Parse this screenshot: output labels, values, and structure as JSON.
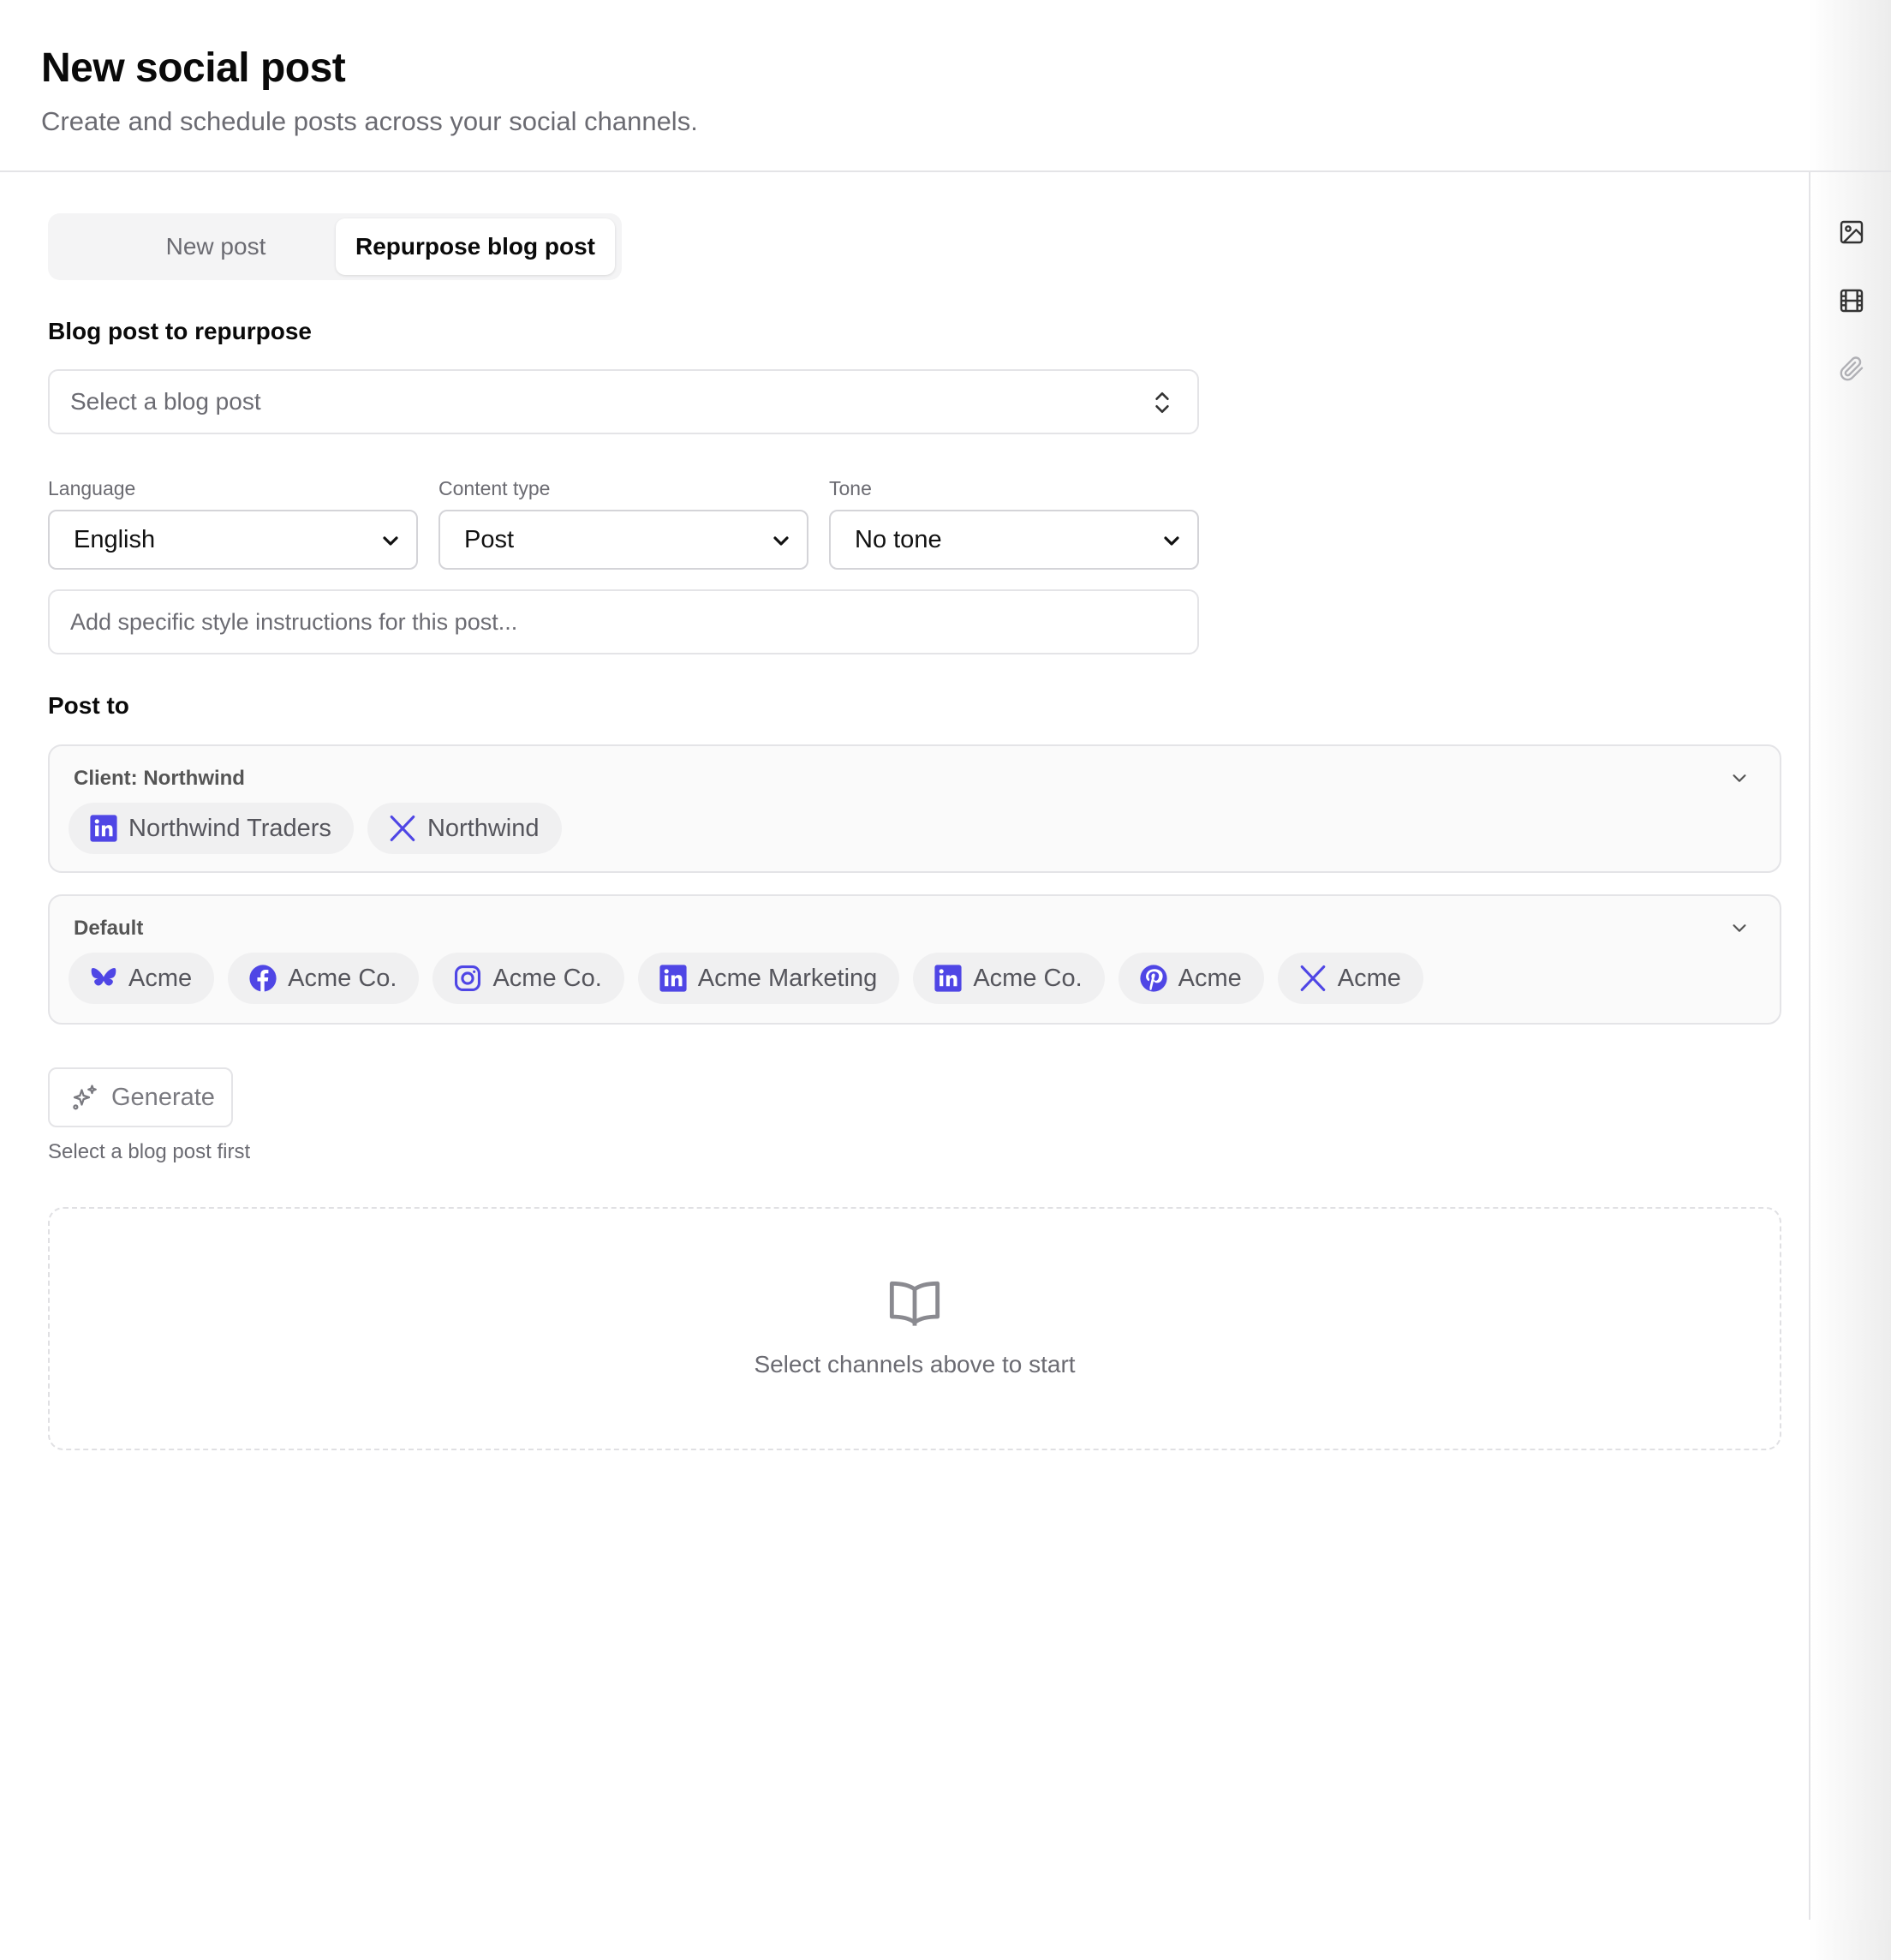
{
  "header": {
    "title": "New social post",
    "subtitle": "Create and schedule posts across your social channels."
  },
  "tabs": [
    {
      "label": "New post",
      "active": false
    },
    {
      "label": "Repurpose blog post",
      "active": true
    }
  ],
  "blog": {
    "label": "Blog post to repurpose",
    "placeholder": "Select a blog post"
  },
  "fields": {
    "language": {
      "label": "Language",
      "value": "English"
    },
    "content_type": {
      "label": "Content type",
      "value": "Post"
    },
    "tone": {
      "label": "Tone",
      "value": "No tone"
    }
  },
  "style_input": {
    "placeholder": "Add specific style instructions for this post..."
  },
  "post_to": {
    "label": "Post to",
    "groups": [
      {
        "title": "Client: Northwind",
        "channels": [
          {
            "icon": "linkedin-icon",
            "name": "Northwind Traders"
          },
          {
            "icon": "x-icon",
            "name": "Northwind"
          }
        ]
      },
      {
        "title": "Default",
        "channels": [
          {
            "icon": "bluesky-icon",
            "name": "Acme"
          },
          {
            "icon": "facebook-icon",
            "name": "Acme Co."
          },
          {
            "icon": "instagram-icon",
            "name": "Acme Co."
          },
          {
            "icon": "linkedin-icon",
            "name": "Acme Marketing"
          },
          {
            "icon": "linkedin-icon",
            "name": "Acme Co."
          },
          {
            "icon": "pinterest-icon",
            "name": "Acme"
          },
          {
            "icon": "x-icon",
            "name": "Acme"
          }
        ]
      }
    ]
  },
  "generate": {
    "label": "Generate",
    "hint": "Select a blog post first"
  },
  "empty_state": {
    "icon": "book-open-icon",
    "message": "Select channels above to start"
  },
  "sidebar": {
    "icons": [
      "image-icon",
      "film-icon",
      "paperclip-icon"
    ]
  },
  "colors": {
    "brand": "#4f46e5",
    "border": "#e4e4e7",
    "muted": "#6b6b72"
  }
}
